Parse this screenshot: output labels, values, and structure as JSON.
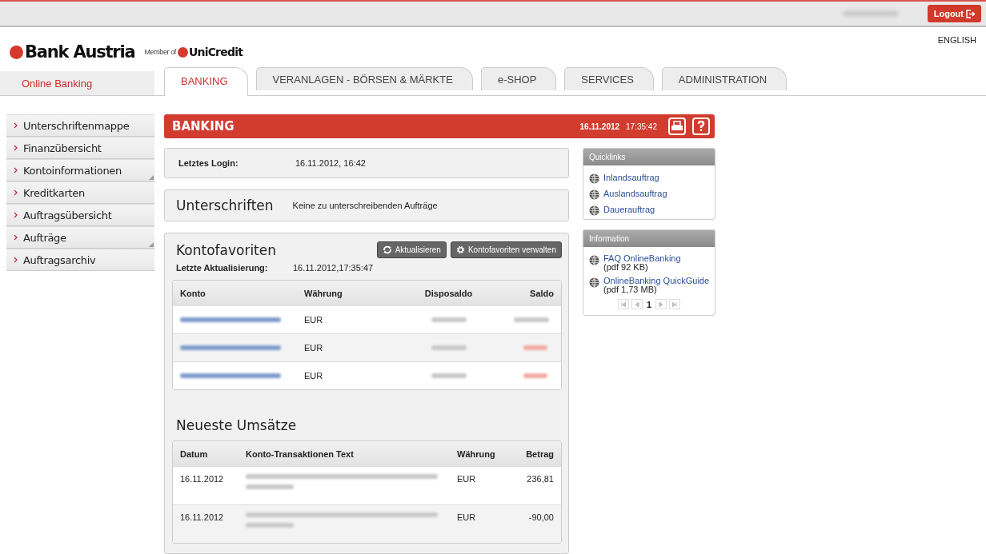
{
  "top_bar": {
    "logout": "Logout"
  },
  "header": {
    "brand": "Bank Austria",
    "member_of": "Member of",
    "parent_brand": "UniCredit",
    "language": "ENGLISH"
  },
  "section_label": "Online Banking",
  "tabs": [
    {
      "label": "BANKING",
      "selected": true
    },
    {
      "label": "VERANLAGEN - BÖRSEN & MÄRKTE",
      "selected": false
    },
    {
      "label": "e-SHOP",
      "selected": false
    },
    {
      "label": "SERVICES",
      "selected": false
    },
    {
      "label": "ADMINISTRATION",
      "selected": false
    }
  ],
  "sidebar": {
    "items": [
      {
        "label": "Unterschriftenmappe",
        "expandable": false
      },
      {
        "label": "Finanzübersicht",
        "expandable": false
      },
      {
        "label": "Kontoinformationen",
        "expandable": true
      },
      {
        "label": "Kreditkarten",
        "expandable": false
      },
      {
        "label": "Auftragsübersicht",
        "expandable": false
      },
      {
        "label": "Aufträge",
        "expandable": true
      },
      {
        "label": "Auftragsarchiv",
        "expandable": false
      }
    ]
  },
  "page_header": {
    "title": "BANKING",
    "date": "16.11.2012",
    "time": "17:35:42"
  },
  "last_login": {
    "label": "Letztes Login:",
    "value": "16.11.2012, 16:42"
  },
  "signatures": {
    "title": "Unterschriften",
    "message": "Keine zu unterschreibenden Aufträge"
  },
  "favorites": {
    "title": "Kontofavoriten",
    "buttons": [
      "Aktualisieren",
      "Kontofavoriten verwalten"
    ],
    "updated_label": "Letzte Aktualisierung:",
    "updated_value": "16.11.2012,17:35:47",
    "columns": [
      "Konto",
      "Währung",
      "Disposaldo",
      "Saldo"
    ],
    "rows": [
      {
        "currency": "EUR",
        "negative": false
      },
      {
        "currency": "EUR",
        "negative": true
      },
      {
        "currency": "EUR",
        "negative": true
      }
    ]
  },
  "transactions": {
    "title": "Neueste Umsätze",
    "columns": [
      "Datum",
      "Konto-Transaktionen Text",
      "Währung",
      "Betrag"
    ],
    "rows": [
      {
        "date": "16.11.2012",
        "currency": "EUR",
        "amount": "236,81"
      },
      {
        "date": "16.11.2012",
        "currency": "EUR",
        "amount": "-90,00"
      }
    ]
  },
  "quicklinks": {
    "title": "Quicklinks",
    "links": [
      {
        "label": "Inlandsauftrag"
      },
      {
        "label": "Auslandsauftrag"
      },
      {
        "label": "Dauerauftrag"
      }
    ]
  },
  "information": {
    "title": "Information",
    "links": [
      {
        "label": "FAQ OnlineBanking",
        "size": "(pdf 92 KB)"
      },
      {
        "label": "OnlineBanking QuickGuide",
        "size": "(pdf 1,73 MB)"
      }
    ],
    "page": "1"
  }
}
